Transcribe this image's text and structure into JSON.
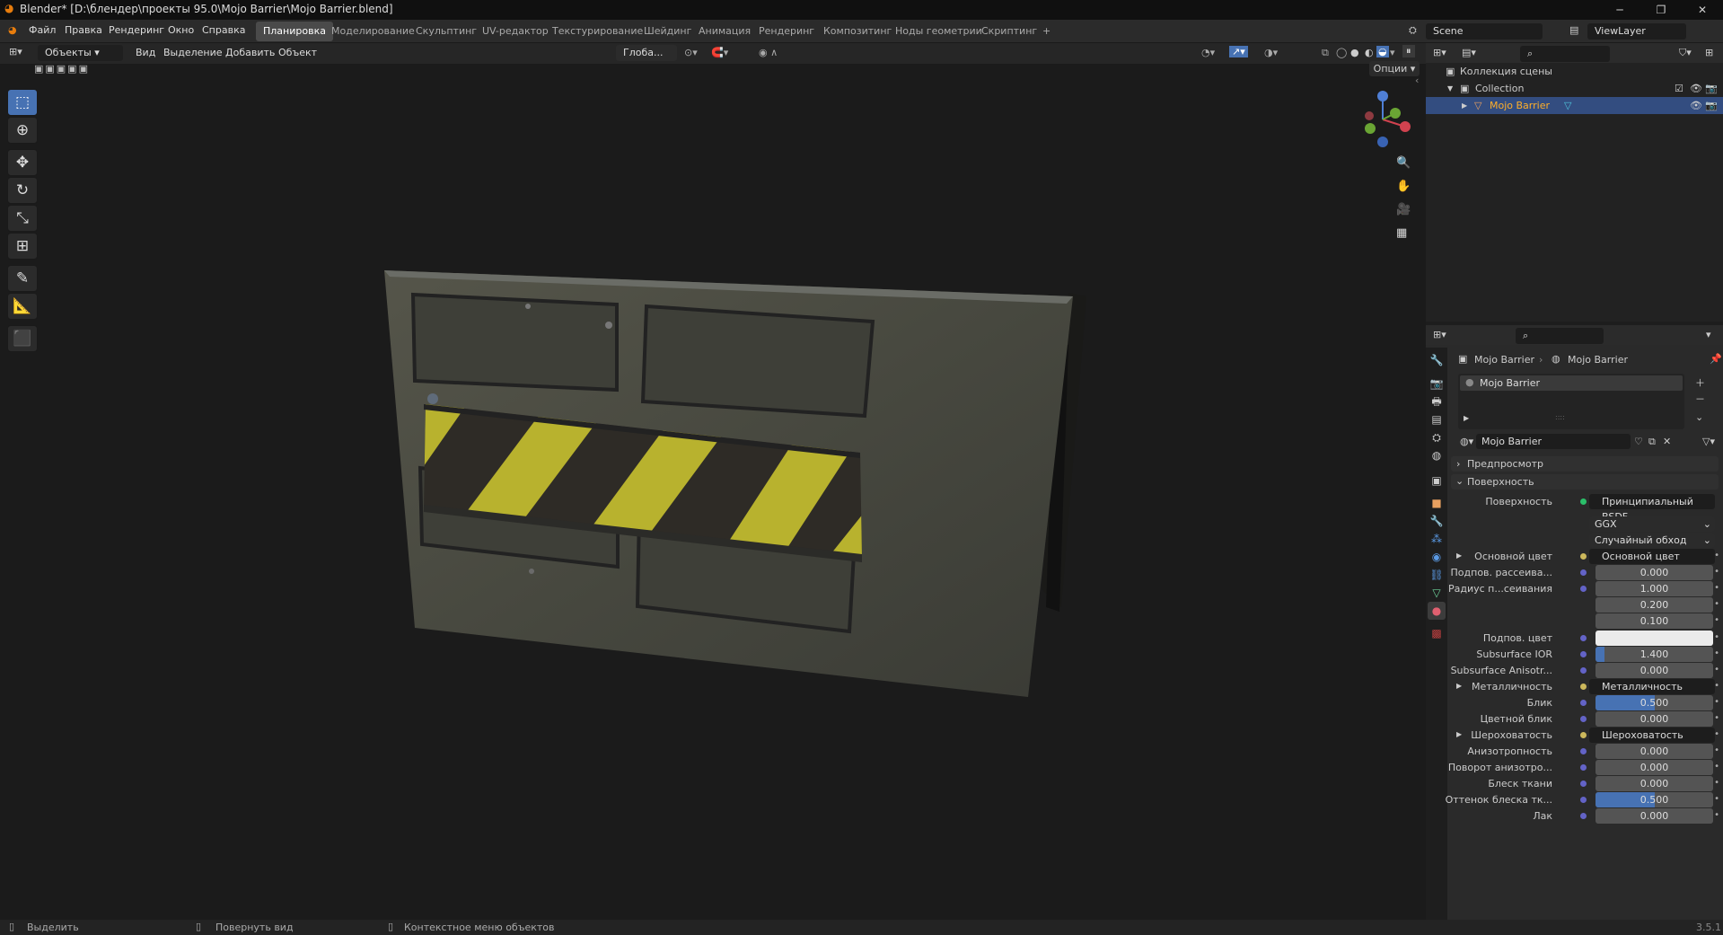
{
  "window": {
    "title": "Blender* [D:\\блендер\\проекты 95.0\\Mojo Barrier\\Mojo Barrier.blend]",
    "minimize": "─",
    "maximize": "❐",
    "close": "✕"
  },
  "menu": {
    "items": [
      "Файл",
      "Правка",
      "Рендеринг",
      "Окно",
      "Справка"
    ]
  },
  "workspaces": [
    "Планировка",
    "Моделирование",
    "Скульптинг",
    "UV-редактор",
    "Текстурирование",
    "Шейдинг",
    "Анимация",
    "Рендеринг",
    "Композитинг",
    "Ноды геометрии",
    "Скриптинг",
    "+"
  ],
  "scene": {
    "name": "Scene",
    "view_layer": "ViewLayer"
  },
  "viewport_header": {
    "mode": "Объекты",
    "menus": [
      "Вид",
      "Выделение",
      "Добавить",
      "Объект"
    ],
    "orientation": "Глоба...",
    "options": "Опции"
  },
  "outliner": {
    "rows": [
      "Коллекция сцены",
      "Collection",
      "Mojo Barrier"
    ]
  },
  "properties": {
    "breadcrumb": [
      "Mojo Barrier",
      "Mojo Barrier"
    ],
    "slot": "Mojo Barrier",
    "material_name": "Mojo Barrier",
    "panels": {
      "preview": "Предпросмотр",
      "surface": "Поверхность"
    },
    "surface_label": "Поверхность",
    "surface_value": "Принципиальный BSDF",
    "distribution": "GGX",
    "subsurface_method": "Случайный обход",
    "rows": [
      {
        "label": "Основной цвет",
        "socket": "Основной цвет"
      },
      {
        "label": "Подпов. рассеива...",
        "value": "0.000",
        "fill": 0
      },
      {
        "label": "Радиус п...сеивания",
        "value": "1.000",
        "fill": 0
      },
      {
        "label": "",
        "value": "0.200",
        "fill": 0
      },
      {
        "label": "",
        "value": "0.100",
        "fill": 0
      },
      {
        "label": "Подпов. цвет",
        "color": "#ebebeb"
      },
      {
        "label": "Subsurface IOR",
        "value": "1.400",
        "fill": 0.08
      },
      {
        "label": "Subsurface Anisotr...",
        "value": "0.000",
        "fill": 0
      },
      {
        "label": "Металличность",
        "socket": "Металличность"
      },
      {
        "label": "Блик",
        "value": "0.500",
        "fill": 0.5
      },
      {
        "label": "Цветной блик",
        "value": "0.000",
        "fill": 0
      },
      {
        "label": "Шероховатость",
        "socket": "Шероховатость"
      },
      {
        "label": "Анизотропность",
        "value": "0.000",
        "fill": 0
      },
      {
        "label": "Поворот анизотро...",
        "value": "0.000",
        "fill": 0
      },
      {
        "label": "Блеск ткани",
        "value": "0.000",
        "fill": 0
      },
      {
        "label": "Оттенок блеска тк...",
        "value": "0.500",
        "fill": 0.5
      },
      {
        "label": "Лак",
        "value": "0.000",
        "fill": 0
      }
    ]
  },
  "status": {
    "select": "Выделить",
    "rotate": "Повернуть вид",
    "context": "Контекстное меню объектов",
    "version": "3.5.1"
  },
  "colors": {
    "accent": "#4772b3",
    "stripe_yellow": "#b8b22e",
    "barrier": "#46473e"
  }
}
